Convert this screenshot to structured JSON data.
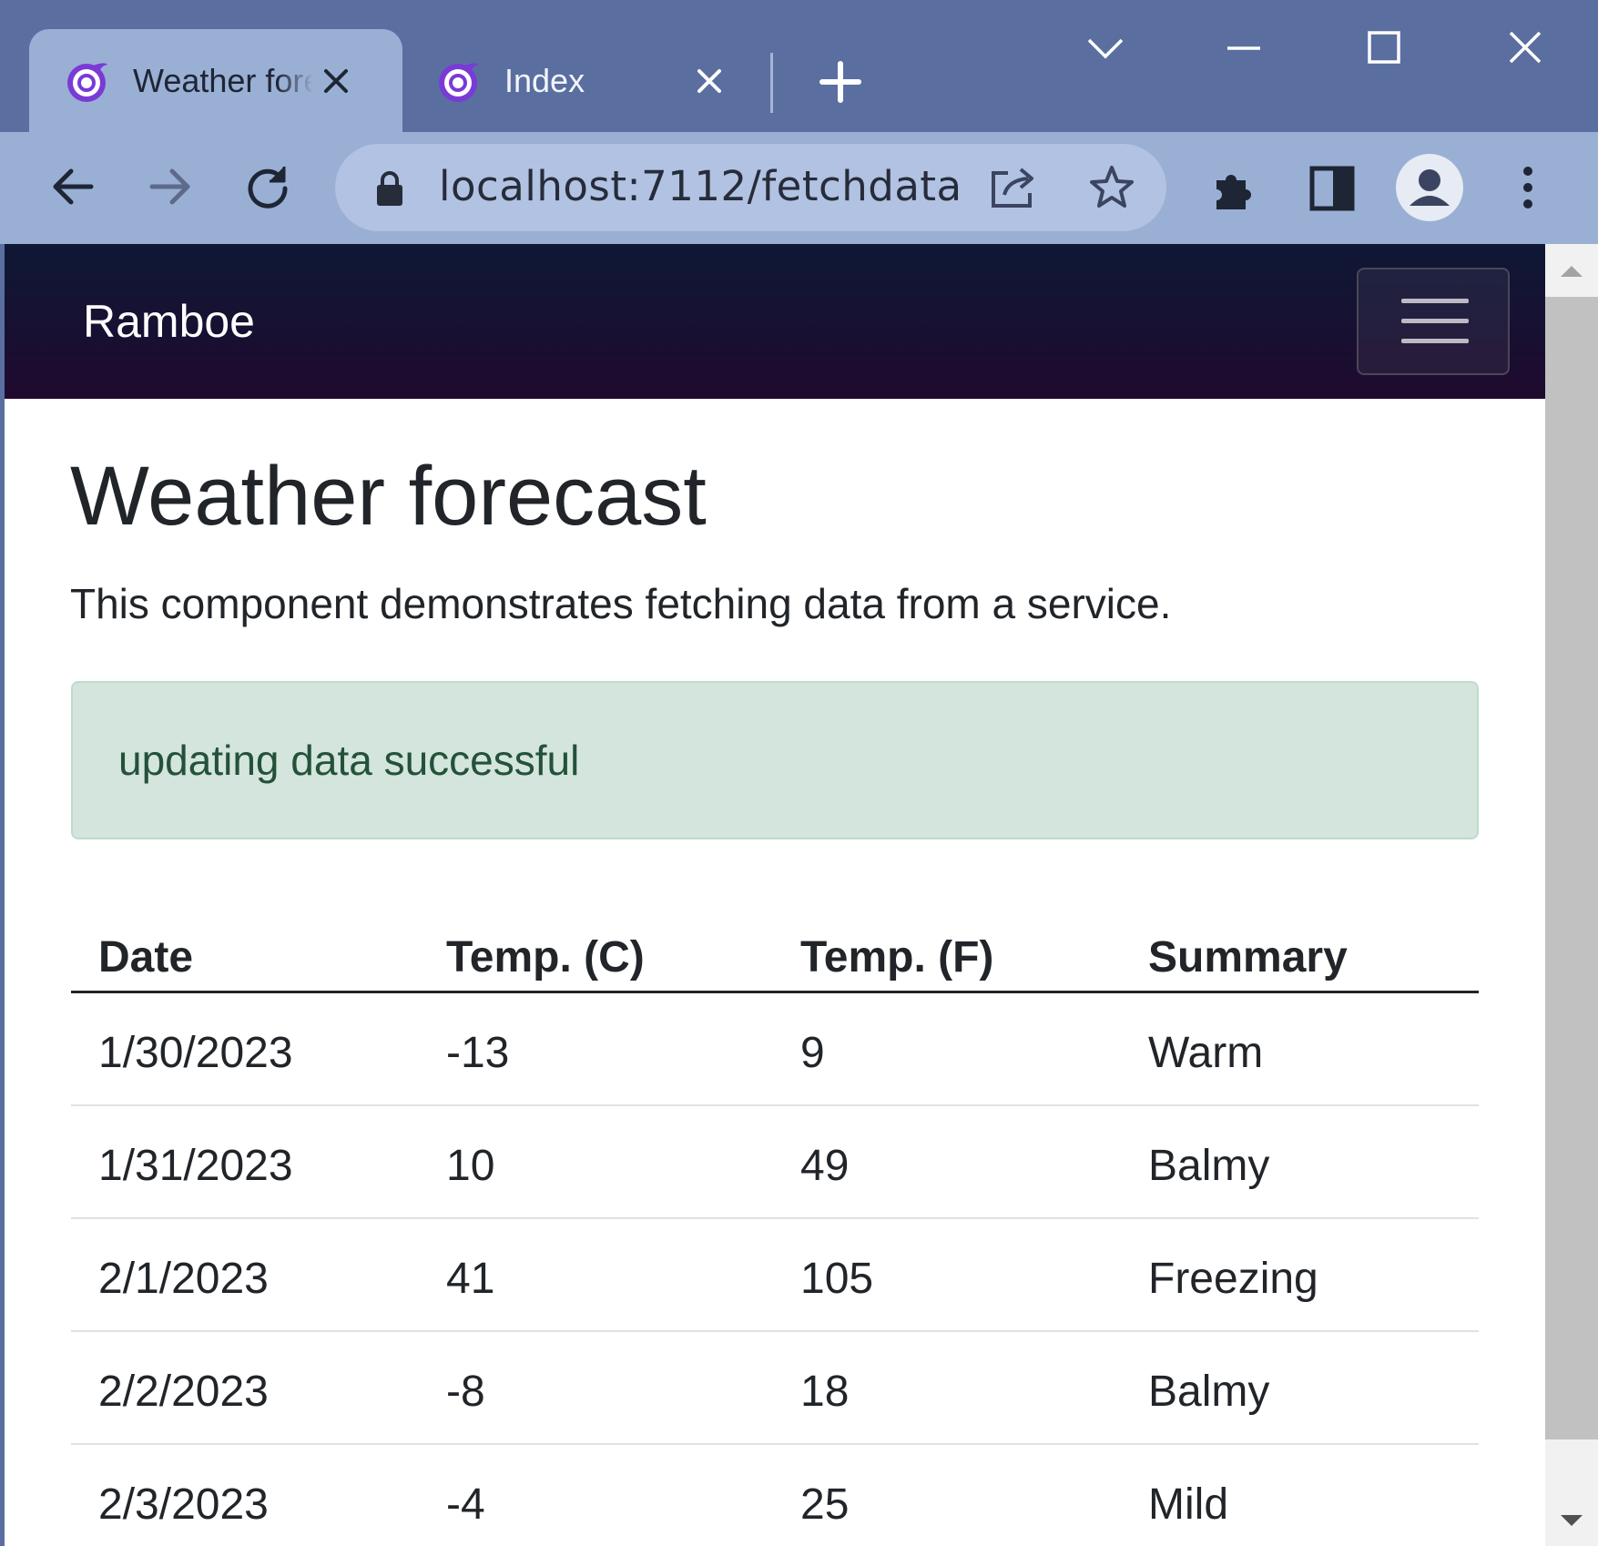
{
  "browser": {
    "tabs": [
      {
        "title": "Weather forecast",
        "active": true
      },
      {
        "title": "Index",
        "active": false
      }
    ],
    "url": "localhost:7112/fetchdata",
    "colors": {
      "titlebar": "#5a6fa0",
      "toolbar": "#9aafd4",
      "omnibox": "#b2c2e2"
    }
  },
  "app": {
    "brand": "Ramboe",
    "header_gradient": [
      "#0f1836",
      "#1f0a2e"
    ]
  },
  "page": {
    "title": "Weather forecast",
    "intro": "This component demonstrates fetching data from a service.",
    "alert": "updating data successful",
    "table": {
      "headers": [
        "Date",
        "Temp. (C)",
        "Temp. (F)",
        "Summary"
      ],
      "rows": [
        [
          "1/30/2023",
          "-13",
          "9",
          "Warm"
        ],
        [
          "1/31/2023",
          "10",
          "49",
          "Balmy"
        ],
        [
          "2/1/2023",
          "41",
          "105",
          "Freezing"
        ],
        [
          "2/2/2023",
          "-8",
          "18",
          "Balmy"
        ],
        [
          "2/3/2023",
          "-4",
          "25",
          "Mild"
        ]
      ]
    }
  }
}
